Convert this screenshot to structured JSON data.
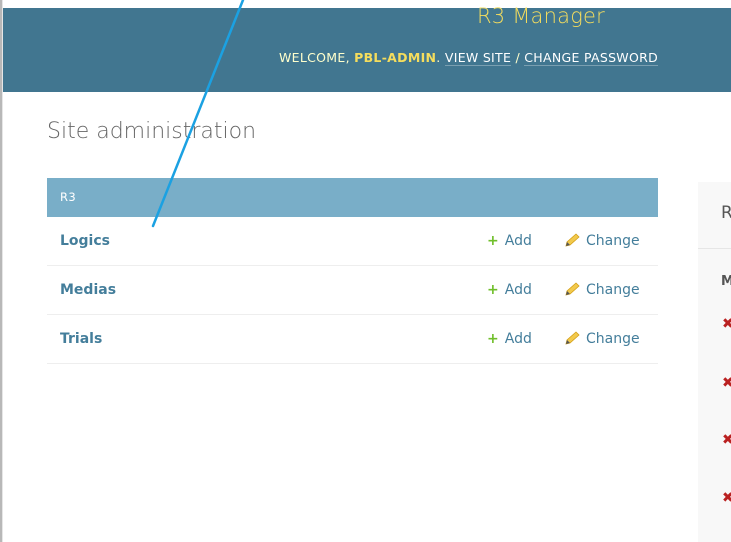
{
  "header": {
    "brand": "R3 Manager",
    "welcome": "WELCOME,",
    "username": "PBL-ADMIN",
    "sep1": ".",
    "view_site": "VIEW SITE",
    "slash": "/",
    "change_password": "CHANGE PASSWORD"
  },
  "page_title": "Site administration",
  "app": {
    "caption": "R3",
    "models": [
      {
        "name": "Logics",
        "add": "Add",
        "change": "Change"
      },
      {
        "name": "Medias",
        "add": "Add",
        "change": "Change"
      },
      {
        "name": "Trials",
        "add": "Add",
        "change": "Change"
      }
    ]
  },
  "recent_actions": {
    "heading": "R",
    "subheading": "M"
  },
  "colors": {
    "header_bg": "#417690",
    "brand": "#f5dd5d",
    "caption_bg": "#79aec8",
    "link": "#447e9b",
    "add_icon": "#70bf2b",
    "delete_icon": "#ba2121",
    "annotation_line": "#1ba1e2"
  },
  "icons": {
    "add": "plus-icon",
    "change": "pencil-icon",
    "delete": "x-icon"
  }
}
